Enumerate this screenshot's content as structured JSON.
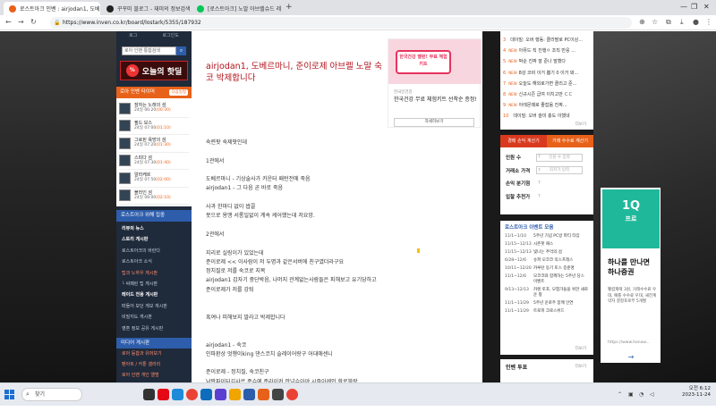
{
  "tabs": [
    {
      "title": "로스트아크 인벤 : airjodan1, 도베르마니",
      "color": "#e8611a"
    },
    {
      "title": "꾸꾸미 블로그 - 재미의 정보검색 사이트",
      "color": "#222222"
    },
    {
      "title": "[로스트아크] 노말 아브렐슈드 레이드",
      "color": "#03c75a"
    }
  ],
  "address": {
    "url": "https://www.inven.co.kr/board/lostark/5355/187932"
  },
  "left": {
    "top_links": [
      "로그",
      "로그인도"
    ],
    "search_placeholder": "로아 인벤 통합검색",
    "banner_text": "오늘의 핫딜",
    "timer_title": "로아 인벤 타이머",
    "timer_more": "다음일정",
    "timers": [
      {
        "name": "잠자는 노래의 섬",
        "day": "24일",
        "time": "06:20",
        "status": "(00:30)"
      },
      {
        "name": "필드 보스",
        "day": "24일",
        "time": "07:00",
        "status": "(01:10)"
      },
      {
        "name": "그로된 욕망의 섬",
        "day": "24일",
        "time": "07:20",
        "status": "(01:30)"
      },
      {
        "name": "스피다 섬",
        "day": "24일",
        "time": "07:30",
        "status": "(01:40)"
      },
      {
        "name": "알라케르",
        "day": "24일",
        "time": "07:50",
        "status": "(02:00)"
      },
      {
        "name": "블라인 섬",
        "day": "24일",
        "time": "08:00",
        "status": "(02:10)"
      }
    ],
    "menu_title": "로스트아크 위해 집중",
    "menu": [
      {
        "label": "리뷰의 뉴스",
        "style": "hl"
      },
      {
        "label": "스토리 게시판",
        "style": "hl"
      },
      {
        "label": "로스트아크의 바란다",
        "style": ""
      },
      {
        "label": "로스트아크 소식",
        "style": ""
      },
      {
        "label": "팁과 노하우 게시판",
        "style": "red"
      },
      {
        "label": "└ 싸페린 팁 게시판",
        "style": ""
      },
      {
        "label": "레이드 전용 게시판",
        "style": "hl"
      },
      {
        "label": "떠들어 보던 게보 게시판",
        "style": ""
      },
      {
        "label": "비밀지도 게시판",
        "style": ""
      },
      {
        "label": "영혼 정보 공유 게시판",
        "style": ""
      }
    ],
    "media_title": "미디어 게시판",
    "media": [
      {
        "label": "로아 등합과 유머보기"
      },
      {
        "label": "팬아트 / 카툰 갤러리"
      },
      {
        "label": "로아 인벤 개인 앨범"
      }
    ]
  },
  "article": {
    "title": "airjodan1, 도베르마니, 준이로제 아브렐 노말 숙코 박제합니다",
    "lines": [
      "숙련팟 숙제팟인데",
      "",
      "1관에서",
      "",
      "도베르마니 - 기상술사가 카운터 패턴전에 죽음",
      "airjodan1 - 그 다음 곧 바로 죽음",
      "",
      "사과 한마디 없이 쌉콜",
      "못으로 용맹 서롱일없이 계속 케어했는데 저요망.",
      "",
      "2관에서",
      "",
      "지리로 실링이가 있었는데",
      "준이로제 << 이사람이 저 두명과 같은서버에 친구였더라구요",
      "정치질로 저를 숙코로 지목",
      "airjodan1 갑자기 중단박음, 나머지 관계없는사람들은 피해보고 유기당하고",
      "준이로제가 저를 강퇴",
      "",
      "",
      "혹여나 피해보지 말라고 박제합니다",
      "",
      "",
      "airjodan1 - 숙코",
      "인파환상 엇챙이king 댄스코치 슬레이어랑구 어대애센니",
      "",
      "준이로제 - 정치질, 숙코친구",
      "남판파이터김샤르 준슈에 준라이커 안넝슈아야 시즐아케인 할로블랑"
    ]
  },
  "ad_top": {
    "tag_text": "한국건강 밸런! 무료 체험키트",
    "brand": "한국인건강",
    "title": "한국건강 무료 체험키트 선착순 증정!",
    "button": "자세히보기"
  },
  "hot": {
    "items": [
      {
        "n": "3",
        "up": "",
        "text": "데이빌: 오버 행동: 클라팔로 PC이상..."
      },
      {
        "n": "4",
        "up": "NEW",
        "text": "아뮤드 직 진행ㅇ 조직 반응 ..."
      },
      {
        "n": "5",
        "up": "NEW",
        "text": "박순 진짜 잘 준나 말했다"
      },
      {
        "n": "6",
        "up": "NEW",
        "text": "8강 코비 이거 뽑기 0 이거 봐..."
      },
      {
        "n": "7",
        "up": "NEW",
        "text": "오늘도 해외로가면 클리고 준..."
      },
      {
        "n": "8",
        "up": "NEW",
        "text": "신규시즌 급여 이치고만 ㄷㄷ"
      },
      {
        "n": "9",
        "up": "NEW",
        "text": "아레몬때로 줄잡음 진짜..."
      },
      {
        "n": "10",
        "up": "",
        "text": "데이빌: 오버 슬미 충도 이했네"
      }
    ],
    "more": "더보기"
  },
  "calc": {
    "tab1": "경매 손익 계산기",
    "tab2": "거래 수수료 계산기",
    "rows": [
      {
        "label": "인원 수",
        "placeholder": "인원 수 입력"
      },
      {
        "label": "거래소 가격",
        "placeholder": "최저가 입력"
      },
      {
        "label": "손익 분기점",
        "placeholder": ""
      },
      {
        "label": "입찰 추천가",
        "placeholder": ""
      }
    ]
  },
  "event": {
    "title": "로스트아크 이벤트 모음",
    "items": [
      {
        "date": "11/1~1/10",
        "text": "5주년 기념 PC방 파티 타임"
      },
      {
        "date": "11/15~12/13",
        "text": "시즌팟 패스"
      },
      {
        "date": "11/15~12/13",
        "text": "빛나는 추억의 섬"
      },
      {
        "date": "6/28~12/6",
        "text": "슈퍼 모코코 익스프레스"
      },
      {
        "date": "10/11~12/20",
        "text": "카루탄 동기 토스 증준명"
      },
      {
        "date": "11/1~12/6",
        "text": "모코코와 함께하는 5주년 당스 이벤트"
      },
      {
        "date": "9/13~12/13",
        "text": "카렌 토포, 모험가들을 위한 새로운 팡"
      },
      {
        "date": "11/1~11/29",
        "text": "5주년 운로주 함께 인연"
      },
      {
        "date": "11/1~11/29",
        "text": "트로피 크로스위드"
      }
    ],
    "more": "더보기"
  },
  "vote": {
    "title": "인벤 투표",
    "more": "더보기"
  },
  "ad_side": {
    "logo": "1Q",
    "logo_sub": "프로",
    "headline": "하나를 만나면 하나증권",
    "desc": "펠컴재택 3원, 거래수수료 우대, 예를 수수료 우대, 새전계약자 결정포로부 5개월",
    "url": "https://www.hanaw..."
  },
  "taskbar": {
    "search": "찾기",
    "time": "오전 6:12",
    "date": "2023-11-24"
  }
}
